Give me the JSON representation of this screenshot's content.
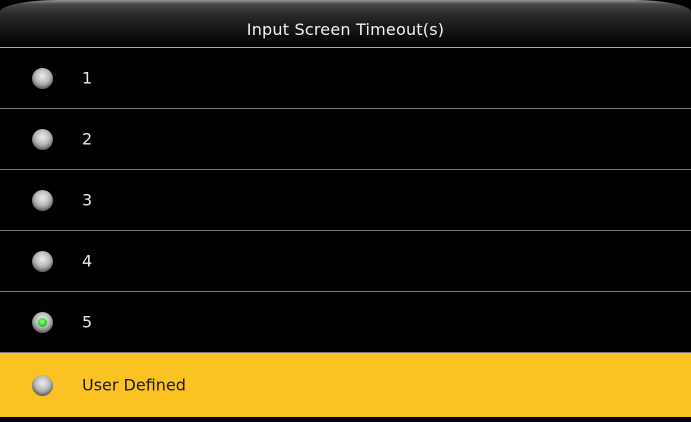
{
  "header": {
    "title": "Input Screen Timeout(s)"
  },
  "options": [
    {
      "label": "1",
      "selected": false,
      "highlighted": false
    },
    {
      "label": "2",
      "selected": false,
      "highlighted": false
    },
    {
      "label": "3",
      "selected": false,
      "highlighted": false
    },
    {
      "label": "4",
      "selected": false,
      "highlighted": false
    },
    {
      "label": "5",
      "selected": true,
      "highlighted": false
    },
    {
      "label": "User Defined",
      "selected": false,
      "highlighted": true
    }
  ],
  "colors": {
    "background": "#000000",
    "highlight": "#fbc224",
    "selected_dot": "#2ed12a",
    "separator": "#7a7a7a"
  },
  "icons": {
    "radio_unselected": "radio-button-icon",
    "radio_selected": "radio-button-selected-icon"
  }
}
